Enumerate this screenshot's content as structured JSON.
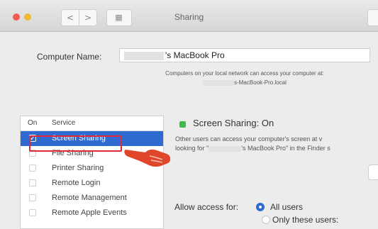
{
  "window": {
    "title": "Sharing",
    "nav": {
      "back": "<",
      "forward": ">",
      "grid": "▦"
    }
  },
  "computer_name": {
    "label": "Computer Name:",
    "value": "'s MacBook Pro"
  },
  "network_note": {
    "line1": "Computers on your local network can access your computer at:",
    "line2": "s-MacBook-Pro.local"
  },
  "services": {
    "header_on": "On",
    "header_service": "Service",
    "items": [
      {
        "label": "Screen Sharing",
        "checked": true,
        "selected": true
      },
      {
        "label": "File Sharing",
        "checked": false,
        "selected": false
      },
      {
        "label": "Printer Sharing",
        "checked": false,
        "selected": false
      },
      {
        "label": "Remote Login",
        "checked": false,
        "selected": false
      },
      {
        "label": "Remote Management",
        "checked": false,
        "selected": false
      },
      {
        "label": "Remote Apple Events",
        "checked": false,
        "selected": false
      }
    ]
  },
  "status": {
    "text": "Screen Sharing: On",
    "color": "#3dbb4a"
  },
  "description": {
    "line1": "Other users can access your computer's screen at v",
    "line2a": "looking for \"",
    "line2b": "'s MacBook Pro\" in the Finder s"
  },
  "access": {
    "label": "Allow access for:",
    "options": [
      "All users",
      "Only these users:"
    ],
    "selected": "All users"
  },
  "colors": {
    "selection": "#2e6ad0",
    "highlight_box": "#e02a3a",
    "hand": "#e0462a"
  }
}
